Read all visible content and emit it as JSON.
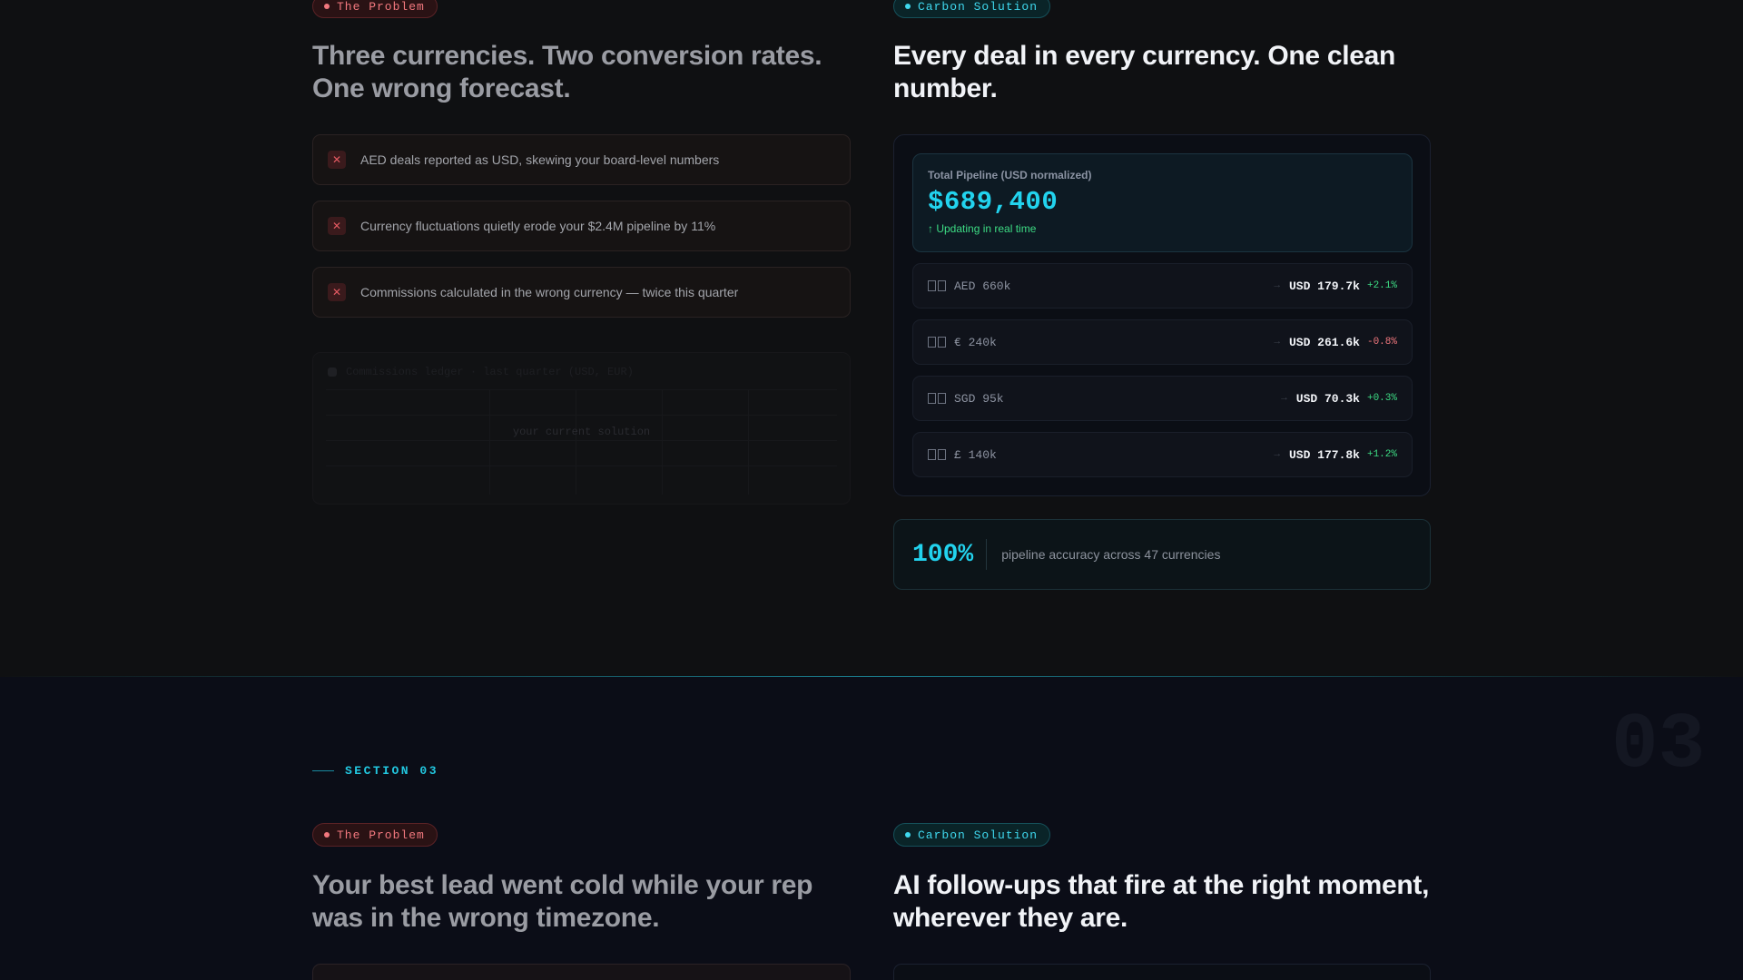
{
  "section_top": {
    "problem": {
      "pill": "The Problem",
      "heading_line1": "Three currencies. Two conversion rates.",
      "heading_line2": "One wrong forecast.",
      "items": [
        "AED deals reported as USD, skewing your board-level numbers",
        "Currency fluctuations quietly erode your $2.4M pipeline by 11%",
        "Commissions calculated in the wrong currency — twice this quarter"
      ],
      "ghost_title": "Commissions ledger · last quarter (USD, EUR)",
      "ghost_center": "your current solution"
    },
    "solution": {
      "pill": "Carbon Solution",
      "heading_line1": "Every deal in every currency. One clean",
      "heading_line2": "number.",
      "total": {
        "label": "Total Pipeline (USD normalized)",
        "value": "$689,400",
        "status": "↑ Updating in real time"
      },
      "rows": [
        {
          "source": "AED 660k",
          "arrow": "→",
          "usd": "USD 179.7k",
          "change": "+2.1%"
        },
        {
          "source": "€ 240k",
          "arrow": "→",
          "usd": "USD 261.6k",
          "change": "-0.8%"
        },
        {
          "source": "SGD 95k",
          "arrow": "→",
          "usd": "USD 70.3k",
          "change": "+0.3%"
        },
        {
          "source": "£ 140k",
          "arrow": "→",
          "usd": "USD 177.8k",
          "change": "+1.2%"
        }
      ],
      "stat": {
        "value": "100%",
        "label": "pipeline accuracy across 47 currencies"
      }
    }
  },
  "section_bottom": {
    "number": "03",
    "label": "SECTION 03",
    "problem": {
      "pill": "The Problem",
      "heading_line1": "Your best lead went cold while your rep",
      "heading_line2": "was in the wrong timezone."
    },
    "solution": {
      "pill": "Carbon Solution",
      "heading_line1": "AI follow-ups that fire at the right moment,",
      "heading_line2": "wherever they are."
    }
  },
  "colors": {
    "accent": "#22d3ee",
    "problem": "#f2787e",
    "positive": "#3ddc84",
    "negative": "#f2787e"
  }
}
